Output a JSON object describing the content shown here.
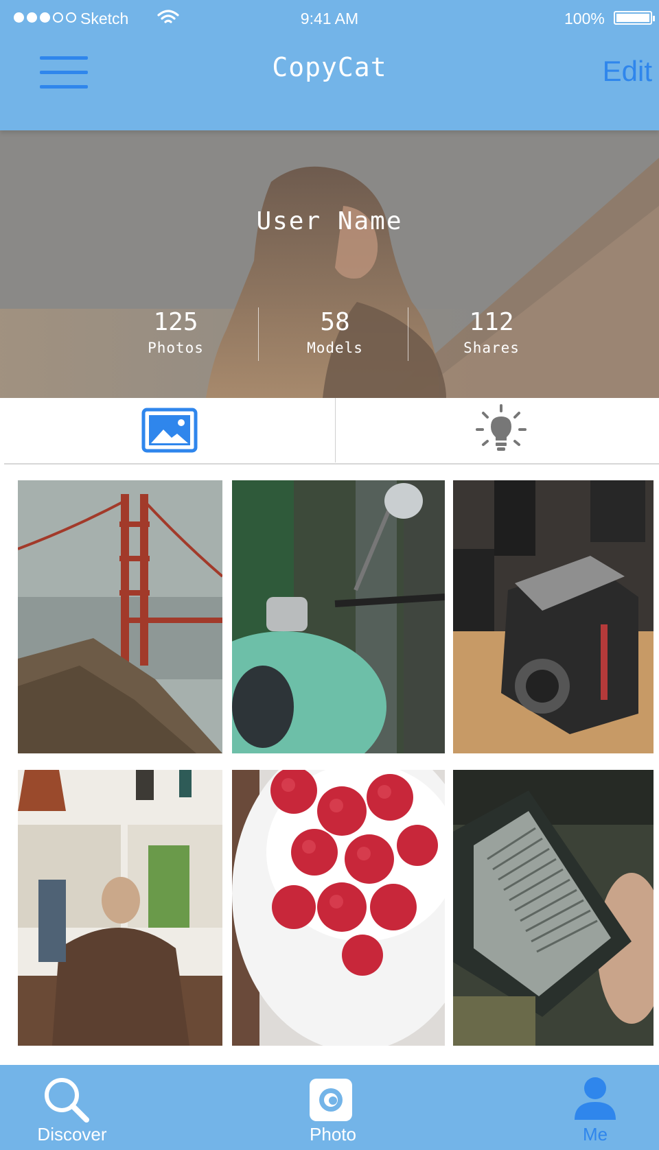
{
  "status_bar": {
    "carrier": "Sketch",
    "time": "9:41 AM",
    "battery": "100%",
    "signal_bars_filled": 3,
    "signal_bars_total": 5
  },
  "nav": {
    "menu_icon": "hamburger-menu-icon",
    "title": "CopyCat",
    "edit_label": "Edit"
  },
  "profile": {
    "user_name": "User Name",
    "stats": [
      {
        "value": "125",
        "label": "Photos"
      },
      {
        "value": "58",
        "label": "Models"
      },
      {
        "value": "112",
        "label": "Shares"
      }
    ]
  },
  "tabs": [
    {
      "icon": "image-icon",
      "selected": true
    },
    {
      "icon": "lightbulb-icon",
      "selected": false
    }
  ],
  "gallery": [
    {
      "icon": "photo-golden-gate-bridge"
    },
    {
      "icon": "photo-scooter"
    },
    {
      "icon": "photo-vintage-camera"
    },
    {
      "icon": "photo-cafe-man"
    },
    {
      "icon": "photo-raspberries"
    },
    {
      "icon": "photo-ereader"
    }
  ],
  "tabbar": {
    "items": [
      {
        "label": "Discover",
        "icon": "search-icon",
        "active": false
      },
      {
        "label": "Photo",
        "icon": "camera-icon",
        "active": false
      },
      {
        "label": "Me",
        "icon": "person-icon",
        "active": true
      }
    ]
  },
  "colors": {
    "bar_background": "#73b4e8",
    "accent": "#2f86ec",
    "text_light": "#ffffff"
  }
}
